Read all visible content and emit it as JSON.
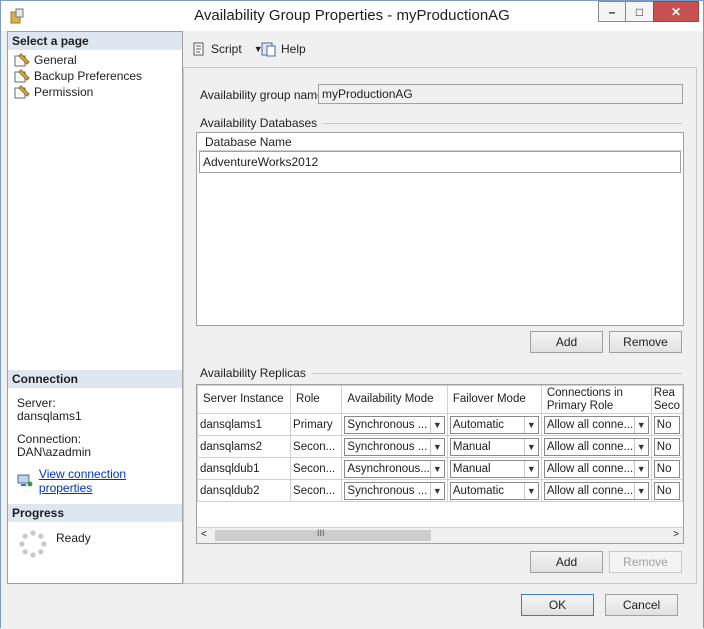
{
  "window": {
    "title": "Availability Group Properties - myProductionAG",
    "minimize": "–",
    "maximize": "□",
    "close": "✕"
  },
  "left": {
    "select_page_header": "Select a page",
    "pages": [
      "General",
      "Backup Preferences",
      "Permission"
    ],
    "connection_header": "Connection",
    "server_label": "Server:",
    "server_value": "dansqlams1",
    "connection_label": "Connection:",
    "connection_value": "DAN\\azadmin",
    "view_link": "View connection properties",
    "progress_header": "Progress",
    "progress_status": "Ready"
  },
  "toolbar": {
    "script_label": "Script",
    "help_label": "Help"
  },
  "general": {
    "ag_name_label": "Availability group name:",
    "ag_name_value": "myProductionAG",
    "databases_title": "Availability Databases",
    "db_column": "Database Name",
    "databases": [
      "AdventureWorks2012"
    ],
    "db_add": "Add",
    "db_remove": "Remove",
    "replicas_title": "Availability Replicas",
    "replica_columns": [
      "Server Instance",
      "Role",
      "Availability Mode",
      "Failover Mode",
      "Connections in Primary Role",
      "Rea Seco"
    ],
    "replicas": [
      {
        "server": "dansqlams1",
        "role": "Primary",
        "mode": "Synchronous ...",
        "failover": "Automatic",
        "primary_conn": "Allow all conne...",
        "readable": "No"
      },
      {
        "server": "dansqlams2",
        "role": "Secon...",
        "mode": "Synchronous ...",
        "failover": "Manual",
        "primary_conn": "Allow all conne...",
        "readable": "No"
      },
      {
        "server": "dansqldub1",
        "role": "Secon...",
        "mode": "Asynchronous...",
        "failover": "Manual",
        "primary_conn": "Allow all conne...",
        "readable": "No"
      },
      {
        "server": "dansqldub2",
        "role": "Secon...",
        "mode": "Synchronous ...",
        "failover": "Automatic",
        "primary_conn": "Allow all conne...",
        "readable": "No"
      }
    ],
    "replica_add": "Add",
    "replica_remove": "Remove"
  },
  "footer": {
    "ok": "OK",
    "cancel": "Cancel"
  }
}
